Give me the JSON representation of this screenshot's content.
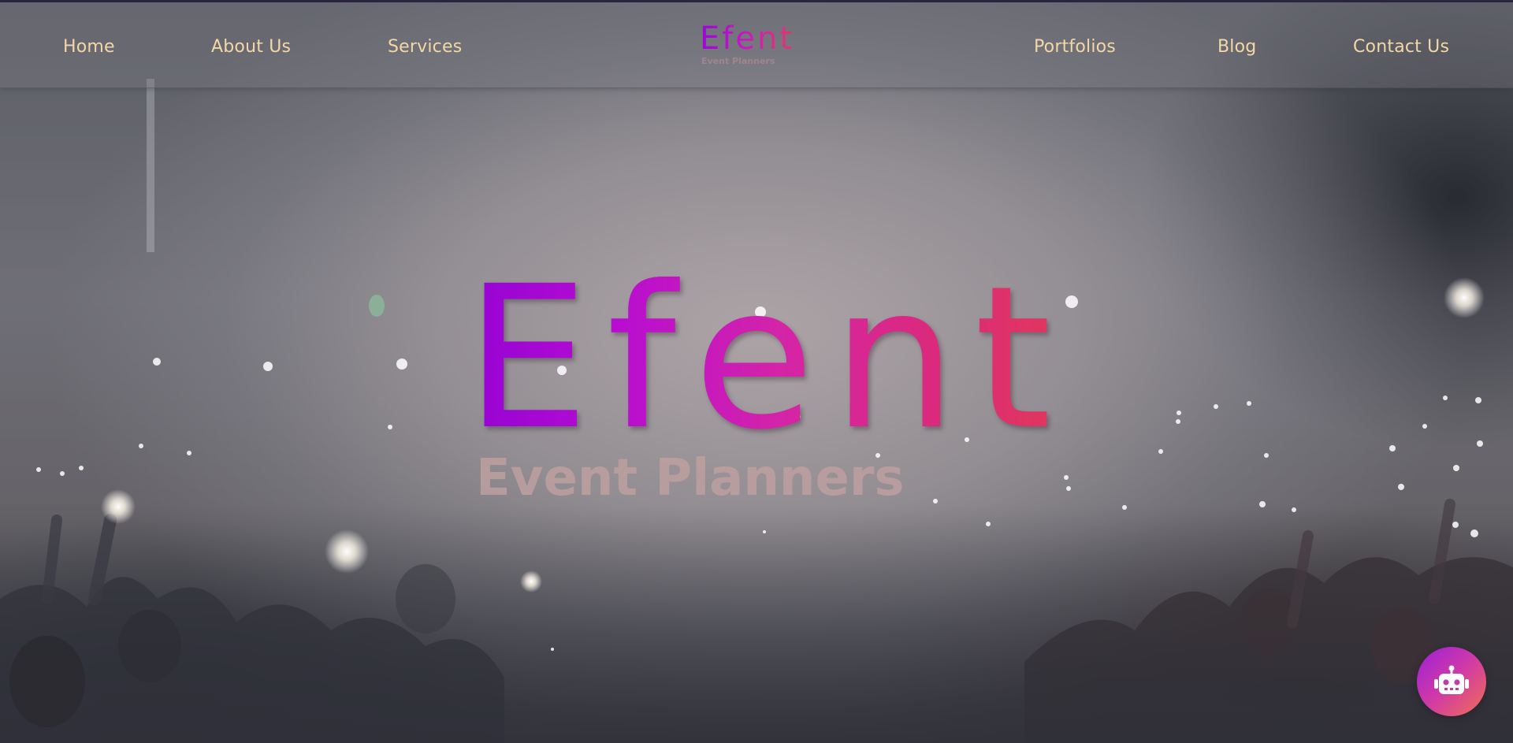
{
  "nav": {
    "left_links": [
      "Home",
      "About Us",
      "Services"
    ],
    "right_links": [
      "Portfolios",
      "Blog",
      "Contact Us"
    ],
    "link_color": "#f4d7a6"
  },
  "brand": {
    "name": "Efent",
    "tagline": "Event Planners"
  },
  "hero": {
    "title": "Efent",
    "subtitle": "Event Planners",
    "gradient": [
      "#9503d4",
      "#d424a8",
      "#e23b52"
    ]
  },
  "chatbot": {
    "icon": "robot-icon",
    "gradient": [
      "#9b1fd8",
      "#d13aa6",
      "#f0704f"
    ]
  }
}
